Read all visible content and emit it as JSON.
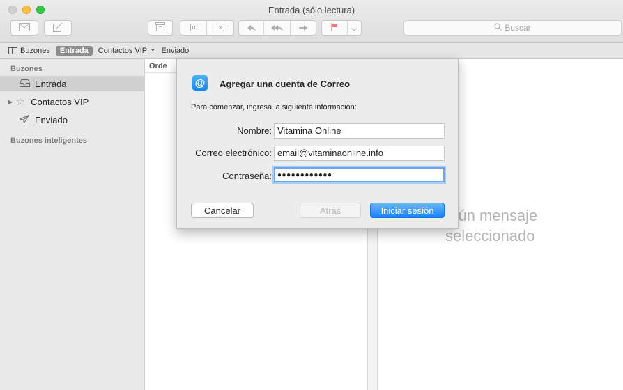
{
  "window": {
    "title": "Entrada (sólo lectura)"
  },
  "toolbar": {
    "search_placeholder": "Buscar",
    "search_icon": "magnifier-icon"
  },
  "favorites_bar": {
    "mailboxes_label": "Buzones",
    "entrada_label": "Entrada",
    "vip_label": "Contactos VIP",
    "vip_chevron": "⌄",
    "sent_label": "Enviado"
  },
  "sidebar": {
    "heading_mailboxes": "Buzones",
    "items": [
      {
        "label": "Entrada",
        "icon": "inbox-tray-icon",
        "selected": true
      },
      {
        "label": "Contactos VIP",
        "icon": "star-icon",
        "selected": false
      },
      {
        "label": "Enviado",
        "icon": "paper-plane-icon",
        "selected": false
      }
    ],
    "heading_smart": "Buzones inteligentes"
  },
  "message_list": {
    "sort_label": "Orde"
  },
  "viewer": {
    "empty_line1": "ngún mensaje",
    "empty_line2": "seleccionado"
  },
  "dialog": {
    "icon_glyph": "@",
    "title": "Agregar una cuenta de Correo",
    "subtitle": "Para comenzar, ingresa la siguiente información:",
    "fields": {
      "name_label": "Nombre:",
      "name_value": "Vitamina Online",
      "email_label": "Correo electrónico:",
      "email_value": "email@vitaminaonline.info",
      "password_label": "Contraseña:",
      "password_value": "●●●●●●●●●●●●"
    },
    "buttons": {
      "cancel": "Cancelar",
      "back": "Atrás",
      "sign_in": "Iniciar sesión"
    }
  },
  "colors": {
    "accent": "#1a82fb",
    "sidebar_bg": "#e9e9ea",
    "focus_ring": "#6aa6f0"
  }
}
